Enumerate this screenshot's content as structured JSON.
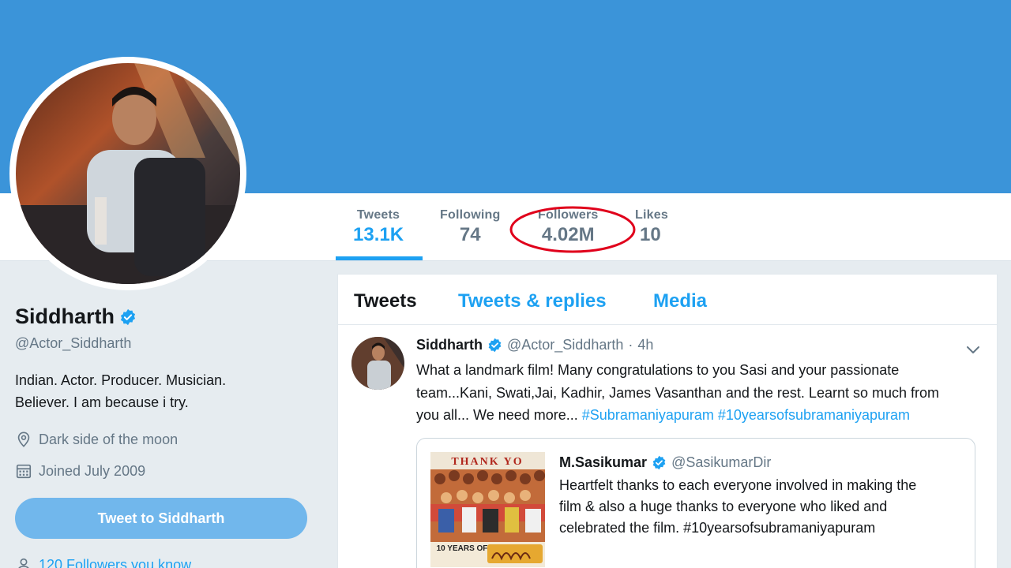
{
  "profile": {
    "name": "Siddharth",
    "handle": "@Actor_Siddharth",
    "bio_line1": "Indian. Actor. Producer. Musician.",
    "bio_line2": "Believer. I am because i try.",
    "location": "Dark side of the moon",
    "joined": "Joined July 2009",
    "tweet_to_label": "Tweet to Siddharth",
    "followers_you_know": "120 Followers you know"
  },
  "stats": [
    {
      "label": "Tweets",
      "value": "13.1K"
    },
    {
      "label": "Following",
      "value": "74"
    },
    {
      "label": "Followers",
      "value": "4.02M"
    },
    {
      "label": "Likes",
      "value": "10"
    }
  ],
  "tabs": [
    "Tweets",
    "Tweets & replies",
    "Media"
  ],
  "tweet": {
    "author": "Siddharth",
    "handle": "@Actor_Siddharth",
    "separator": "·",
    "time": "4h",
    "text_line1": "What a landmark film! Many congratulations to you Sasi and your passionate",
    "text_line2": "team...Kani, Swati,Jai, Kadhir, James Vasanthan and the rest. Learnt so much from",
    "text_line3_plain": "you all... We need more... ",
    "hashtag1": "#Subramaniyapuram",
    "hashtag2": "#10yearsofsubramaniyapuram",
    "quote": {
      "author": "M.Sasikumar",
      "handle": "@SasikumarDir",
      "line1": "Heartfelt thanks to each everyone involved in making the",
      "line2": "film & also a huge thanks to everyone who liked and",
      "line3": "celebrated the film. #10yearsofsubramaniyapuram",
      "image_text_top": "THANK YO",
      "image_text_bottom": "10 YEARS OF"
    }
  },
  "colors": {
    "banner": "#3b94d9",
    "accent": "#1da1f2",
    "highlight": "#e0001b"
  }
}
